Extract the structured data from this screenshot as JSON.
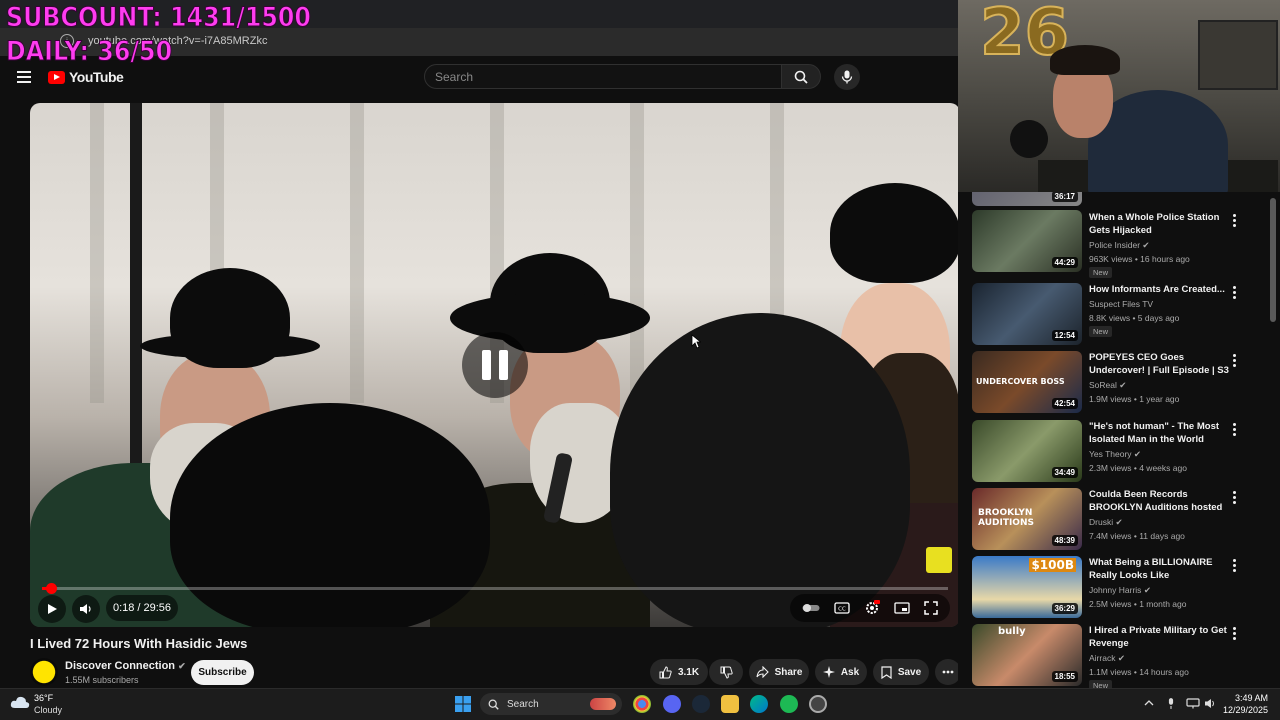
{
  "overlay": {
    "subcount": "SUBCOUNT: 1431/1500",
    "daily": "DAILY: 36/50"
  },
  "browser": {
    "url": "youtube.com/watch?v=-i7A85MRZkc"
  },
  "header": {
    "logo_text": "YouTube",
    "search_placeholder": "Search"
  },
  "player": {
    "current_time": "0:18",
    "duration": "29:56",
    "progress": 0.01
  },
  "video": {
    "title": "I Lived 72 Hours With Hasidic Jews",
    "channel": "Discover Connection",
    "subscribers": "1.55M subscribers",
    "subscribe_label": "Subscribe",
    "likes": "3.1K",
    "share_label": "Share",
    "ask_label": "Ask",
    "save_label": "Save"
  },
  "webcam": {
    "balloon_text": "26"
  },
  "recommendations": [
    {
      "title": "",
      "channel": "",
      "meta": "",
      "duration": "36:17",
      "new": false
    },
    {
      "title": "When a Whole Police Station Gets Hijacked",
      "channel": "Police Insider",
      "verified": true,
      "meta": "963K views • 16 hours ago",
      "duration": "44:29",
      "new": true,
      "new_label": "New"
    },
    {
      "title": "How Informants Are Created...",
      "channel": "Suspect Files TV",
      "verified": false,
      "meta": "8.8K views • 5 days ago",
      "duration": "12:54",
      "new": true,
      "new_label": "New"
    },
    {
      "title": "POPEYES CEO Goes Undercover! | Full Episode | S3 ...",
      "channel": "SoReal",
      "verified": true,
      "meta": "1.9M views • 1 year ago",
      "duration": "42:54",
      "new": false
    },
    {
      "title": "\"He's not human\" - The Most Isolated Man in the World",
      "channel": "Yes Theory",
      "verified": true,
      "meta": "2.3M views • 4 weeks ago",
      "duration": "34:49",
      "new": false
    },
    {
      "title": "Coulda Been Records BROOKLYN Auditions hosted b...",
      "channel": "Druski",
      "verified": true,
      "meta": "7.4M views • 11 days ago",
      "duration": "48:39",
      "new": false
    },
    {
      "title": "What Being a BILLIONAIRE Really Looks Like",
      "channel": "Johnny Harris",
      "verified": true,
      "meta": "2.5M views • 1 month ago",
      "duration": "36:29",
      "new": false
    },
    {
      "title": "I Hired a Private Military to Get Revenge",
      "channel": "Airrack",
      "verified": true,
      "meta": "1.1M views • 14 hours ago",
      "duration": "18:55",
      "new": true,
      "new_label": "New"
    }
  ],
  "thumb_texts": {
    "brooklyn": "BROOKLYN AUDITIONS",
    "undercover": "UNDERCOVER BOSS",
    "billion": "$100B",
    "bully": "bully"
  },
  "taskbar": {
    "weather_temp": "36°F",
    "weather_desc": "Cloudy",
    "search_label": "Search",
    "time": "3:49 AM",
    "date": "12/29/2025"
  }
}
